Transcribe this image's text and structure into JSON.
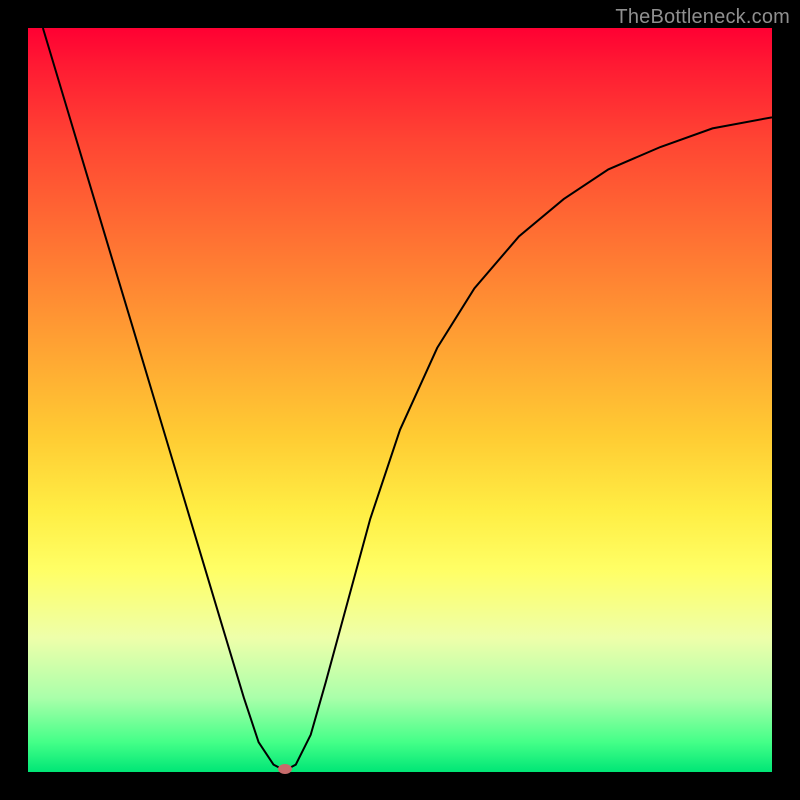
{
  "watermark": "TheBottleneck.com",
  "chart_data": {
    "type": "line",
    "title": "",
    "xlabel": "",
    "ylabel": "",
    "xlim": [
      0,
      100
    ],
    "ylim": [
      0,
      100
    ],
    "grid": false,
    "legend": false,
    "series": [
      {
        "name": "curve",
        "x": [
          2,
          5,
          8,
          11,
          14,
          17,
          20,
          23,
          26,
          29,
          31,
          33,
          34.5,
          36,
          38,
          40,
          43,
          46,
          50,
          55,
          60,
          66,
          72,
          78,
          85,
          92,
          100
        ],
        "values": [
          100,
          90,
          80,
          70,
          60,
          50,
          40,
          30,
          20,
          10,
          4,
          1,
          0.2,
          1,
          5,
          12,
          23,
          34,
          46,
          57,
          65,
          72,
          77,
          81,
          84,
          86.5,
          88
        ]
      }
    ],
    "marker": {
      "x": 34.5,
      "y": 0.4
    },
    "background": {
      "type": "vertical-gradient",
      "stops": [
        {
          "pct": 0,
          "color": "#ff0033"
        },
        {
          "pct": 15,
          "color": "#ff4433"
        },
        {
          "pct": 45,
          "color": "#ffaa33"
        },
        {
          "pct": 65,
          "color": "#ffee44"
        },
        {
          "pct": 82,
          "color": "#eeffaa"
        },
        {
          "pct": 100,
          "color": "#00e676"
        }
      ]
    }
  }
}
